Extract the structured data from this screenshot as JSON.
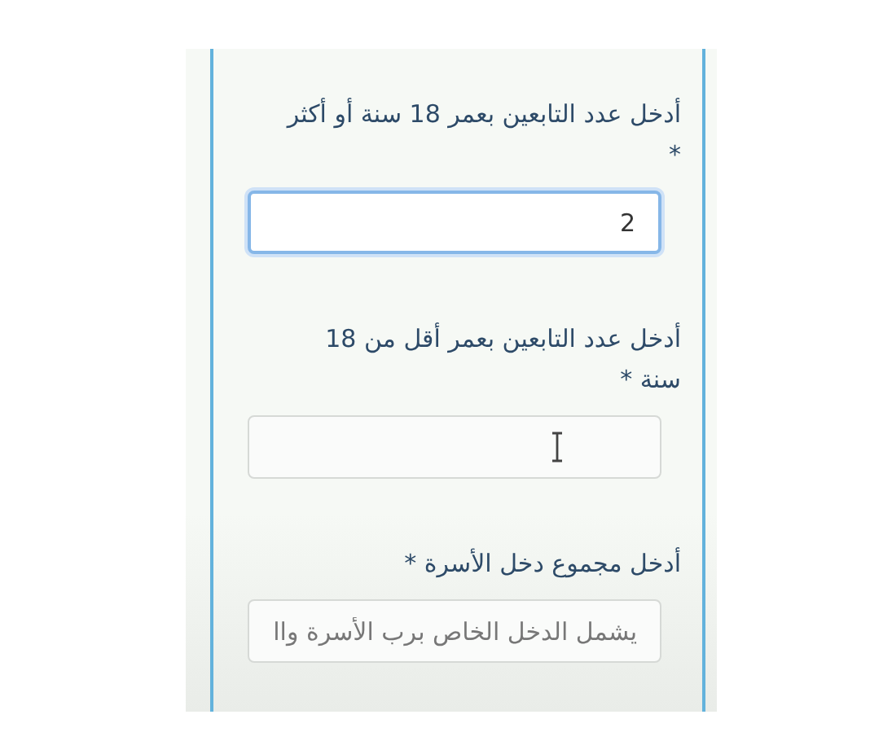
{
  "fields": [
    {
      "label": "أدخل عدد التابعين بعمر 18 سنة أو أكثر *",
      "value": "2",
      "focused": true,
      "hovered": false
    },
    {
      "label": "أدخل عدد التابعين بعمر أقل من 18 سنة *",
      "focused": false,
      "hovered": true
    },
    {
      "label": "أدخل مجموع دخل الأسرة *",
      "placeholder": "يشمل الدخل الخاص برب الأسرة واا",
      "focused": false,
      "hovered": false
    }
  ]
}
